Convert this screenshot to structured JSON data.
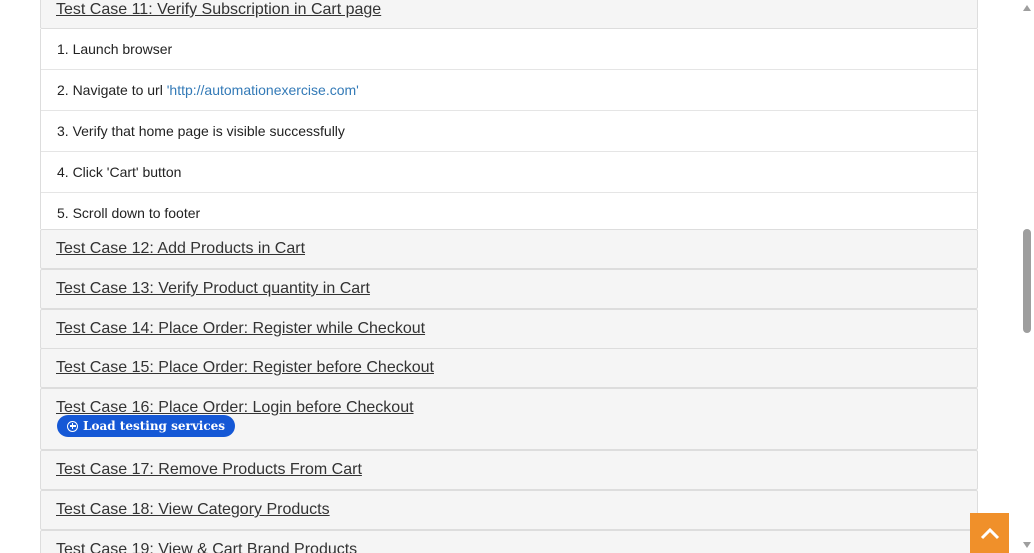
{
  "test_cases": {
    "expanded": {
      "title": "Test Case 11: Verify Subscription in Cart page",
      "steps": [
        {
          "text": "1. Launch browser"
        },
        {
          "text": "2. Navigate to url ",
          "link": "'http://automationexercise.com'"
        },
        {
          "text": "3. Verify that home page is visible successfully"
        },
        {
          "text": "4. Click 'Cart' button"
        },
        {
          "text": "5. Scroll down to footer"
        }
      ]
    },
    "collapsed": [
      {
        "title": "Test Case 12: Add Products in Cart"
      },
      {
        "title": "Test Case 13: Verify Product quantity in Cart"
      },
      {
        "title": "Test Case 14: Place Order: Register while Checkout"
      },
      {
        "title": "Test Case 15: Place Order: Register before Checkout"
      },
      {
        "title": "Test Case 16: Place Order: Login before Checkout"
      },
      {
        "title": "Test Case 17: Remove Products From Cart"
      },
      {
        "title": "Test Case 18: View Category Products"
      },
      {
        "title": "Test Case 19: View & Cart Brand Products"
      }
    ]
  },
  "overlay_button": {
    "label": "Load testing services",
    "icon": "plus-circle-icon",
    "color": "#1558d6"
  },
  "scroll_up_button": {
    "icon": "chevron-up-icon",
    "color": "#f0902a"
  }
}
